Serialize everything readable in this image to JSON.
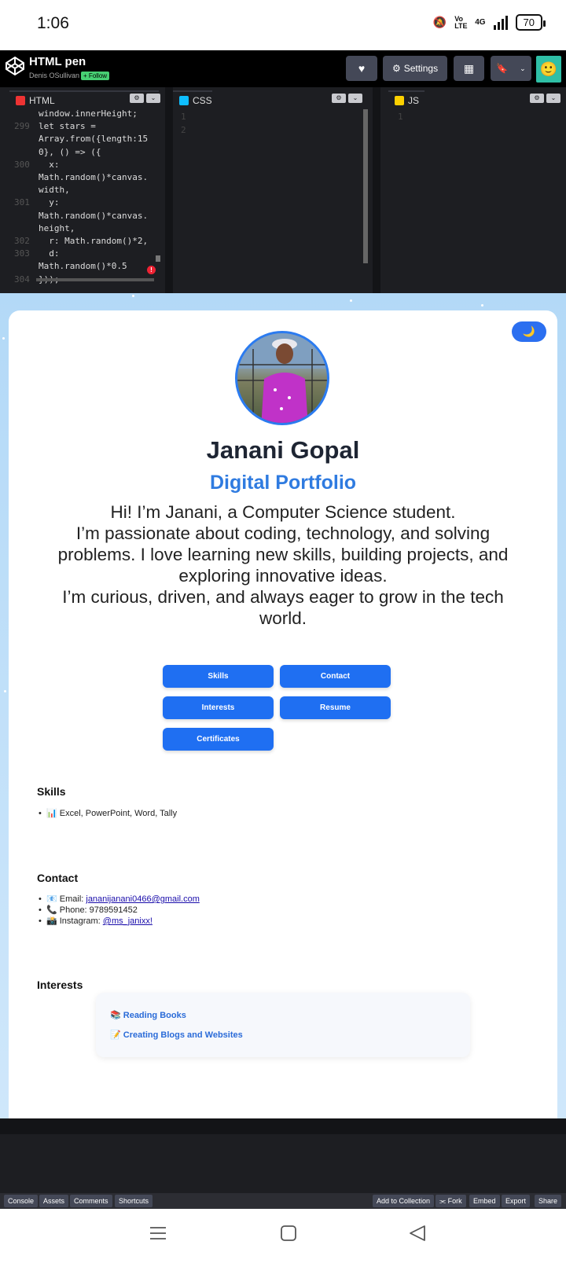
{
  "status_bar": {
    "time": "1:06",
    "network": "4G",
    "volte": "Vo LTE",
    "battery": "70"
  },
  "header": {
    "title": "HTML pen",
    "author": "Denis OSullivan",
    "follow_label": "+ Follow",
    "settings_label": "Settings"
  },
  "editor": {
    "tabs": [
      "HTML",
      "CSS",
      "JS"
    ],
    "html_lines": [
      {
        "n": "",
        "t": "window.innerHeight;"
      },
      {
        "n": "299",
        "t": "let stars ="
      },
      {
        "n": "",
        "t": "Array.from({length:15"
      },
      {
        "n": "",
        "t": "0}, () => ({"
      },
      {
        "n": "300",
        "t": "  x:"
      },
      {
        "n": "",
        "t": "Math.random()*canvas."
      },
      {
        "n": "",
        "t": "width,"
      },
      {
        "n": "301",
        "t": "  y:"
      },
      {
        "n": "",
        "t": "Math.random()*canvas."
      },
      {
        "n": "",
        "t": "height,"
      },
      {
        "n": "302",
        "t": "  r: Math.random()*2,"
      },
      {
        "n": "303",
        "t": "  d:"
      },
      {
        "n": "",
        "t": "Math.random()*0.5"
      },
      {
        "n": "304",
        "t": "}));"
      }
    ],
    "css_lines": [
      "1",
      "2"
    ],
    "js_lines": [
      "1"
    ]
  },
  "preview": {
    "theme_toggle": "🌙",
    "name": "Janani Gopal",
    "subtitle": "Digital Portfolio",
    "bio": [
      "Hi! I’m Janani, a Computer Science student.",
      "I’m passionate about coding, technology, and solving problems. I love learning new skills, building projects, and exploring innovative ideas.",
      "I’m curious, driven, and always eager to grow in the tech world."
    ],
    "buttons": {
      "skills": "Skills",
      "contact": "Contact",
      "interests": "Interests",
      "resume": "Resume",
      "certificates": "Certificates"
    },
    "skills": {
      "heading": "Skills",
      "item": "📊 Excel, PowerPoint, Word, Tally"
    },
    "contact": {
      "heading": "Contact",
      "email_prefix": "📧 Email: ",
      "email": "jananijanani0466@gmail.com",
      "phone": "📞 Phone: 9789591452",
      "instagram_prefix": "📸 Instagram: ",
      "instagram": "@ms_janixx!"
    },
    "interests": {
      "heading": "Interests",
      "items": [
        "📚 Reading Books",
        "📝 Creating Blogs and Websites"
      ]
    }
  },
  "bottom_bar": {
    "left": [
      "Console",
      "Assets",
      "Comments",
      "Shortcuts"
    ],
    "right": [
      "Add to Collection",
      "⫘ Fork",
      "Embed",
      "Export",
      "Share"
    ]
  }
}
